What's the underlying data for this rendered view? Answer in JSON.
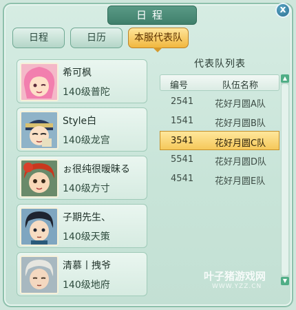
{
  "window": {
    "title": "日程",
    "close_label": "x"
  },
  "tabs": [
    {
      "label": "日程",
      "active": false
    },
    {
      "label": "日历",
      "active": false
    },
    {
      "label": "本服代表队",
      "active": true
    }
  ],
  "members": [
    {
      "name": "希可枫",
      "level": "140级普陀"
    },
    {
      "name": "Style白",
      "level": "140级龙宫"
    },
    {
      "name": "ぉ很纯很暧昧る",
      "level": "140级方寸"
    },
    {
      "name": "子期先生、",
      "level": "140级天策"
    },
    {
      "name": "清慕丨拽爷",
      "level": "140级地府"
    }
  ],
  "team_list": {
    "title": "代表队列表",
    "columns": [
      "编号",
      "队伍名称"
    ],
    "rows": [
      {
        "id": "2541",
        "name": "花好月圆A队",
        "selected": false
      },
      {
        "id": "1541",
        "name": "花好月圆B队",
        "selected": false
      },
      {
        "id": "3541",
        "name": "花好月圆C队",
        "selected": true
      },
      {
        "id": "5541",
        "name": "花好月圆D队",
        "selected": false
      },
      {
        "id": "4541",
        "name": "花好月圆E队",
        "selected": false
      }
    ]
  },
  "watermark": {
    "main": "叶子猪游戏网",
    "sub": "WWW.YZZ.CN"
  },
  "colors": {
    "accent": "#f1b73f",
    "panel": "#c8e4d8",
    "header": "#3f7f6b"
  }
}
